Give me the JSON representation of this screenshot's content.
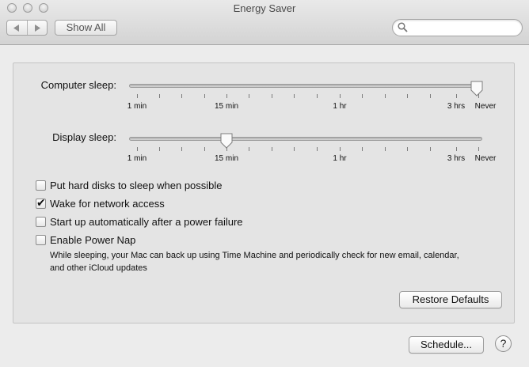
{
  "window": {
    "title": "Energy Saver"
  },
  "toolbar": {
    "back_label": "◀",
    "forward_label": "▶",
    "show_all_label": "Show All",
    "search_placeholder": "",
    "search_value": ""
  },
  "computer_sleep": {
    "label": "Computer sleep:",
    "tick_labels": [
      "1 min",
      "15 min",
      "1 hr",
      "3 hrs",
      "Never"
    ],
    "value": "Never"
  },
  "display_sleep": {
    "label": "Display sleep:",
    "tick_labels": [
      "1 min",
      "15 min",
      "1 hr",
      "3 hrs",
      "Never"
    ],
    "value": "15 min"
  },
  "options": [
    {
      "label": "Put hard disks to sleep when possible",
      "checked": false
    },
    {
      "label": "Wake for network access",
      "checked": true
    },
    {
      "label": "Start up automatically after a power failure",
      "checked": false
    },
    {
      "label": "Enable Power Nap",
      "checked": false
    }
  ],
  "power_nap_note": "While sleeping, your Mac can back up using Time Machine and periodically check for new email, calendar, and other iCloud updates",
  "buttons": {
    "restore_defaults": "Restore Defaults",
    "schedule": "Schedule...",
    "help": "?"
  }
}
